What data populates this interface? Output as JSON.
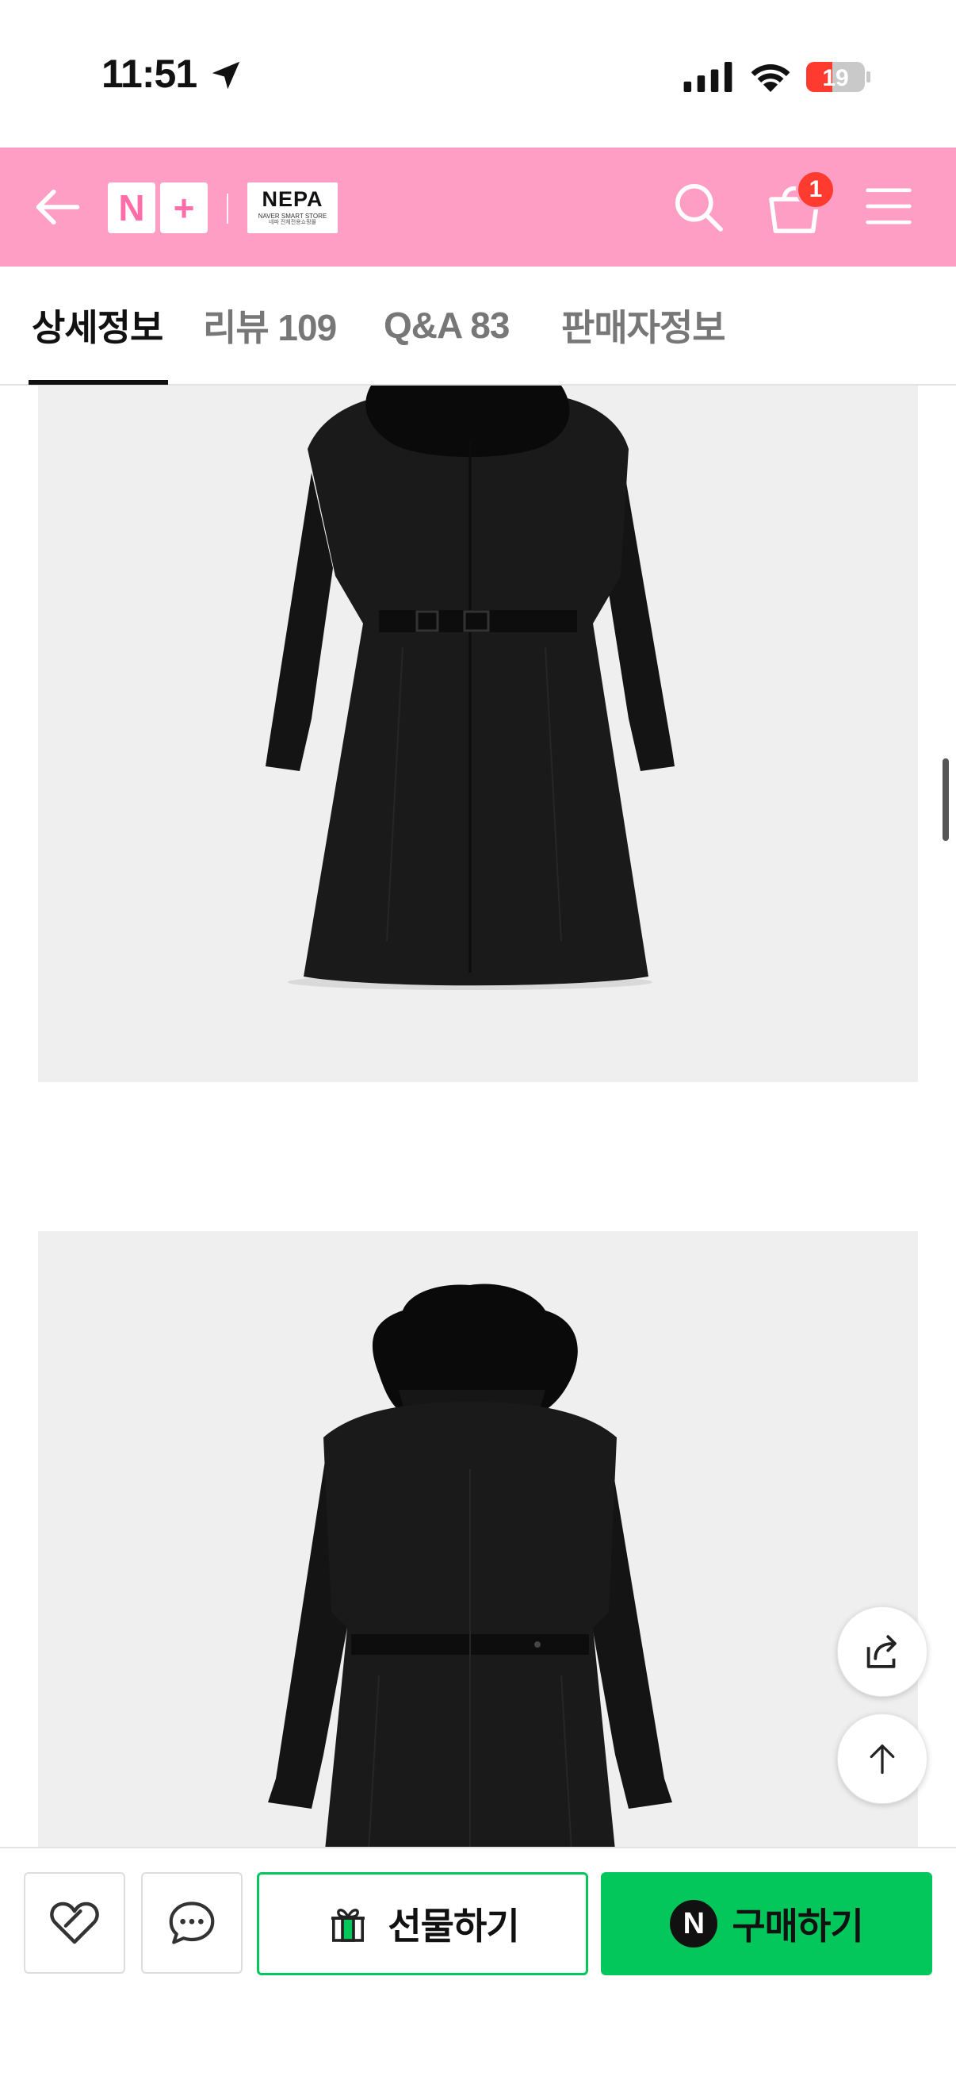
{
  "status_bar": {
    "time": "11:51",
    "battery_level": "19",
    "icons": [
      "location-arrow-icon",
      "cellular-signal-icon",
      "wifi-icon",
      "battery-icon"
    ]
  },
  "header": {
    "back_icon": "arrow-left-icon",
    "logo_n": "N",
    "logo_plus": "+",
    "brand_name": "NEPA",
    "brand_sub": "NAVER SMART STORE",
    "brand_sub2": "네파 전체전용쇼핑몰",
    "search_icon": "search-icon",
    "cart_icon": "shopping-basket-icon",
    "cart_count": "1",
    "menu_icon": "hamburger-menu-icon",
    "bg_color": "#ff9ec4"
  },
  "tabs": {
    "items": [
      {
        "label": "상세정보",
        "active": true
      },
      {
        "label": "리뷰 109",
        "active": false
      },
      {
        "label": "Q&A 83",
        "active": false
      },
      {
        "label": "판매자정보",
        "active": false
      }
    ]
  },
  "content": {
    "images": [
      {
        "subject": "black long belted down coat with fur hood, front view"
      },
      {
        "subject": "black long belted down coat with fur hood, back view"
      }
    ]
  },
  "floating": {
    "share_icon": "share-icon",
    "top_icon": "arrow-up-icon"
  },
  "bottom_bar": {
    "wish_icon": "heart-icon",
    "talk_icon": "chat-bubble-icon",
    "gift_icon": "gift-icon",
    "gift_label": "선물하기",
    "buy_logo": "N",
    "buy_label": "구매하기",
    "accent_color": "#03c75a"
  }
}
